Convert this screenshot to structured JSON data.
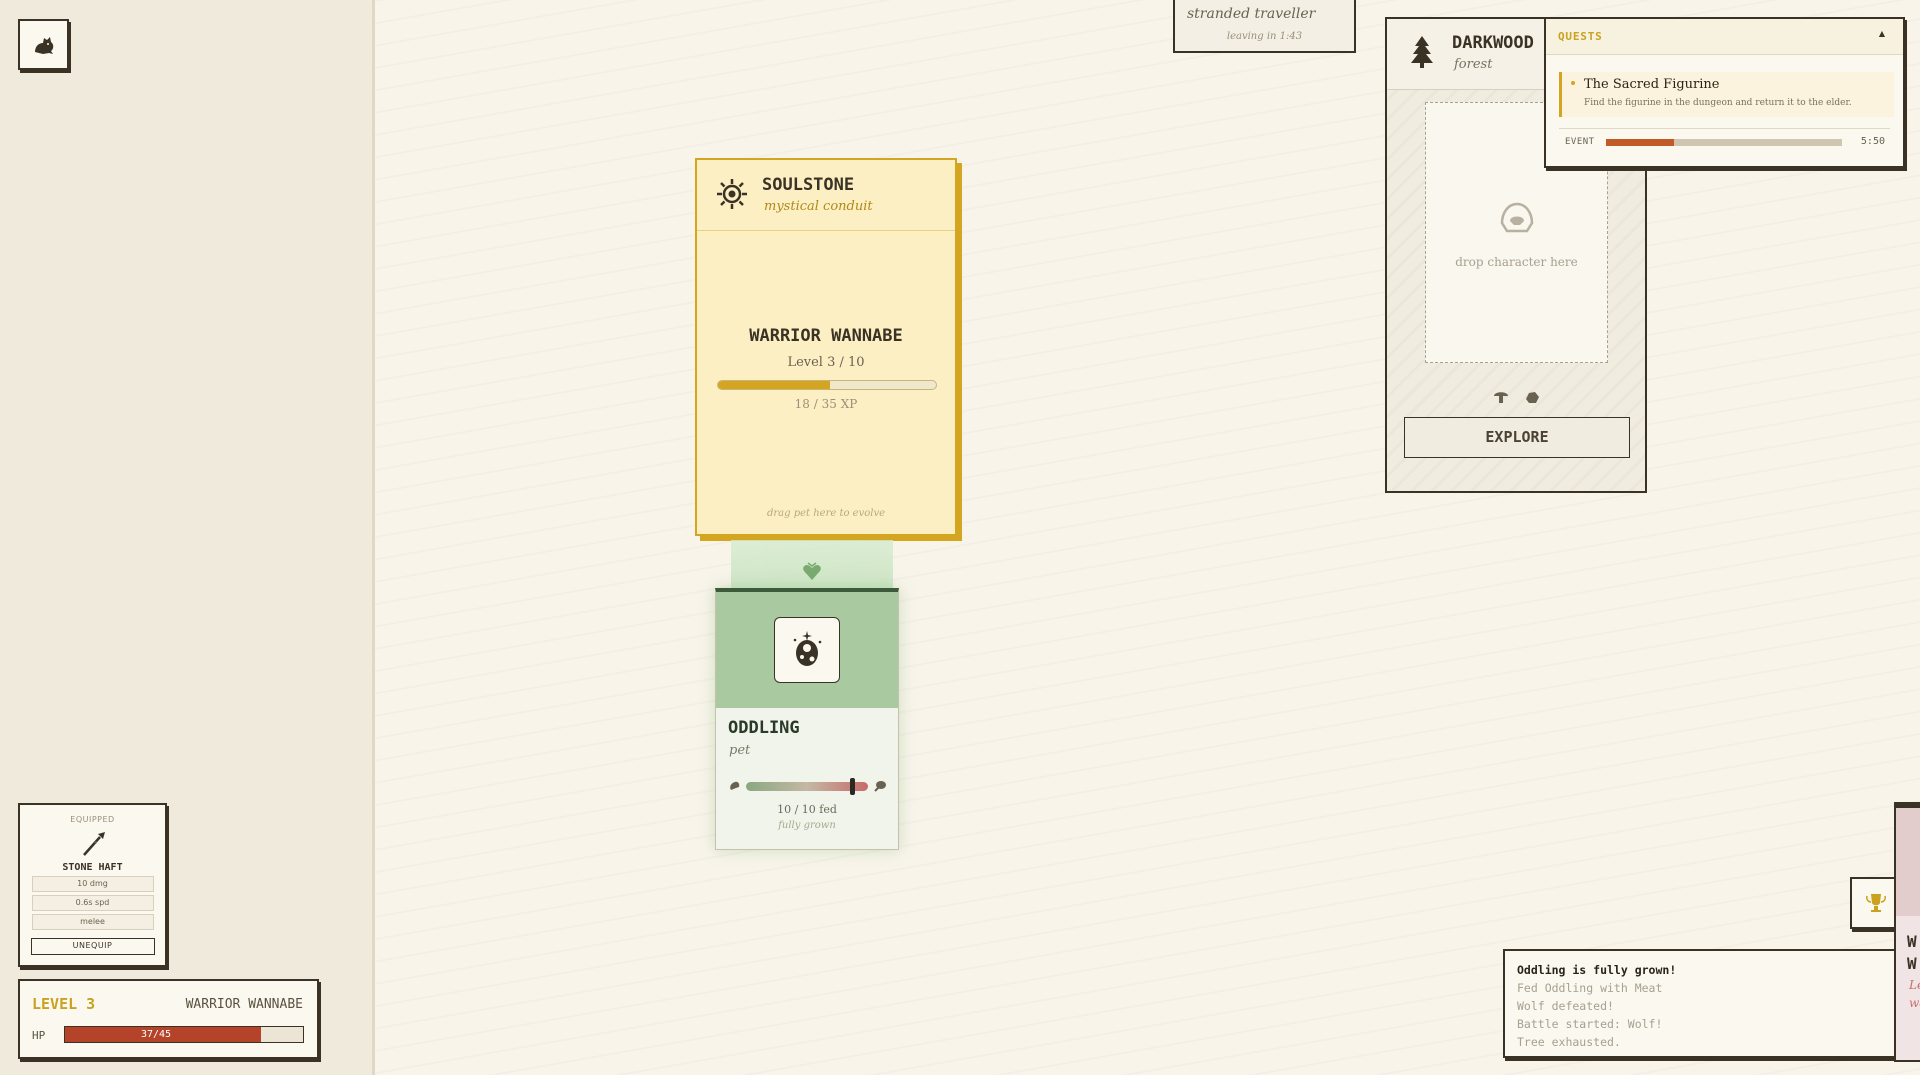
{
  "sidebar": {
    "top_icon": "ferret-pet-icon",
    "equipped": {
      "label": "EQUIPPED",
      "item_icon": "spear-icon",
      "item_name": "STONE HAFT",
      "stats": [
        "10 dmg",
        "0.6s spd",
        "melee"
      ],
      "unequip_label": "UNEQUIP"
    },
    "status": {
      "level_label": "LEVEL 3",
      "class_name": "WARRIOR WANNABE",
      "hp_label": "HP",
      "hp_text": "37/45",
      "hp_fraction": 0.822
    }
  },
  "board": {
    "stranded": {
      "title": "stranded traveller",
      "timer": "leaving in 1:43"
    },
    "soulstone": {
      "icon": "soulstone-sun-icon",
      "title": "SOULSTONE",
      "subtitle": "mystical conduit",
      "class_name": "WARRIOR WANNABE",
      "level_text": "Level 3 / 10",
      "xp_text": "18 / 35 XP",
      "xp_fraction": 0.514,
      "hint": "drag pet here to evolve"
    },
    "connector_icon": "evolve-heart-icon",
    "pet": {
      "portrait_icon": "pet-egg-icon",
      "name": "ODDLING",
      "type": "pet",
      "feed_fraction": 0.85,
      "feed_text": "10 / 10 fed",
      "growth_text": "fully grown"
    },
    "darkwood": {
      "icon": "pine-tree-icon",
      "title": "DARKWOOD",
      "subtitle": "forest",
      "drop_text": "drop character here",
      "explore_label": "EXPLORE"
    },
    "quests": {
      "title": "QUESTS",
      "toggle": "▲",
      "item_name": "The Sacred Figurine",
      "item_desc": "Find the figurine in the dungeon and return it to the elder.",
      "event_label": "EVENT",
      "event_fraction": 0.29,
      "event_time": "5:50"
    },
    "trophy_icon": "trophy-icon",
    "log": [
      "Oddling is fully grown!",
      "Fed Oddling with Meat",
      "Wolf defeated!",
      "Battle started: Wolf!",
      "Tree exhausted."
    ],
    "edge_card": {
      "letters": [
        "W",
        "W"
      ],
      "italic": [
        "Le",
        "wa"
      ]
    }
  },
  "colors": {
    "accent_gold": "#d4a520",
    "hp_red": "#b5432a",
    "pet_green": "#a9c9a1",
    "ink": "#3a3325"
  }
}
